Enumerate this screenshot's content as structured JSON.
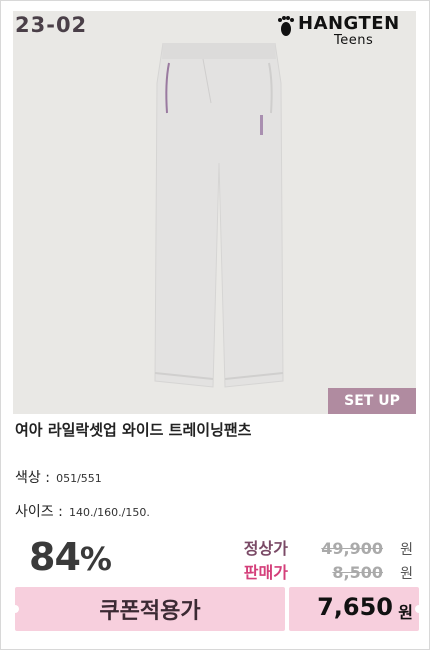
{
  "product": {
    "code": "23-02",
    "brand": {
      "name": "HANGTEN",
      "sub": "Teens"
    },
    "badge": "SET UP",
    "title": "여아 라일락셋업 와이드 트레이닝팬츠",
    "pants_color": "#e4e3e2"
  },
  "options": {
    "color": {
      "label": "색상 :",
      "value": "051/551"
    },
    "size": {
      "label": "사이즈 :",
      "value": "140./160./150."
    }
  },
  "pricing": {
    "discount_rate": "84",
    "discount_unit": "%",
    "regular": {
      "label": "정상가",
      "amount": "49,900",
      "unit": "원"
    },
    "sale": {
      "label": "판매가",
      "amount": "8,500",
      "unit": "원"
    },
    "coupon": {
      "label": "쿠폰적용가",
      "amount": "7,650",
      "unit": "원"
    }
  },
  "colors": {
    "accent_pink": "#f7cfdd",
    "badge_purple": "#b08ba0",
    "sale_pink": "#d43f7a"
  }
}
